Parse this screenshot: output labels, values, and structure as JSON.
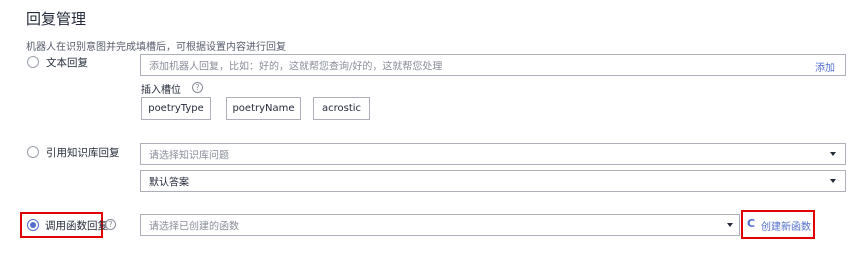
{
  "page": {
    "title": "回复管理",
    "description": "机器人在识别意图并完成填槽后，可根据设置内容进行回复"
  },
  "text_reply": {
    "label": "文本回复",
    "input_placeholder": "添加机器人回复，比如：好的，这就帮您查询/好的，这就帮您处理",
    "add_label": "添加",
    "slots_label": "插入槽位",
    "help_glyph": "?",
    "slots": [
      "poetryType",
      "poetryName",
      "acrostic"
    ]
  },
  "kb_reply": {
    "label": "引用知识库回复",
    "select_placeholder": "请选择知识库问题",
    "answer_value": "默认答案"
  },
  "func_reply": {
    "label": "调用函数回复",
    "help_glyph": "?",
    "select_placeholder": "请选择已创建的函数",
    "refresh_glyph": "C",
    "create_label": "创建新函数"
  },
  "colors": {
    "accent": "#526ecc",
    "highlight_border": "#e00000",
    "border": "#adb0b8",
    "placeholder": "#8a8e99"
  }
}
